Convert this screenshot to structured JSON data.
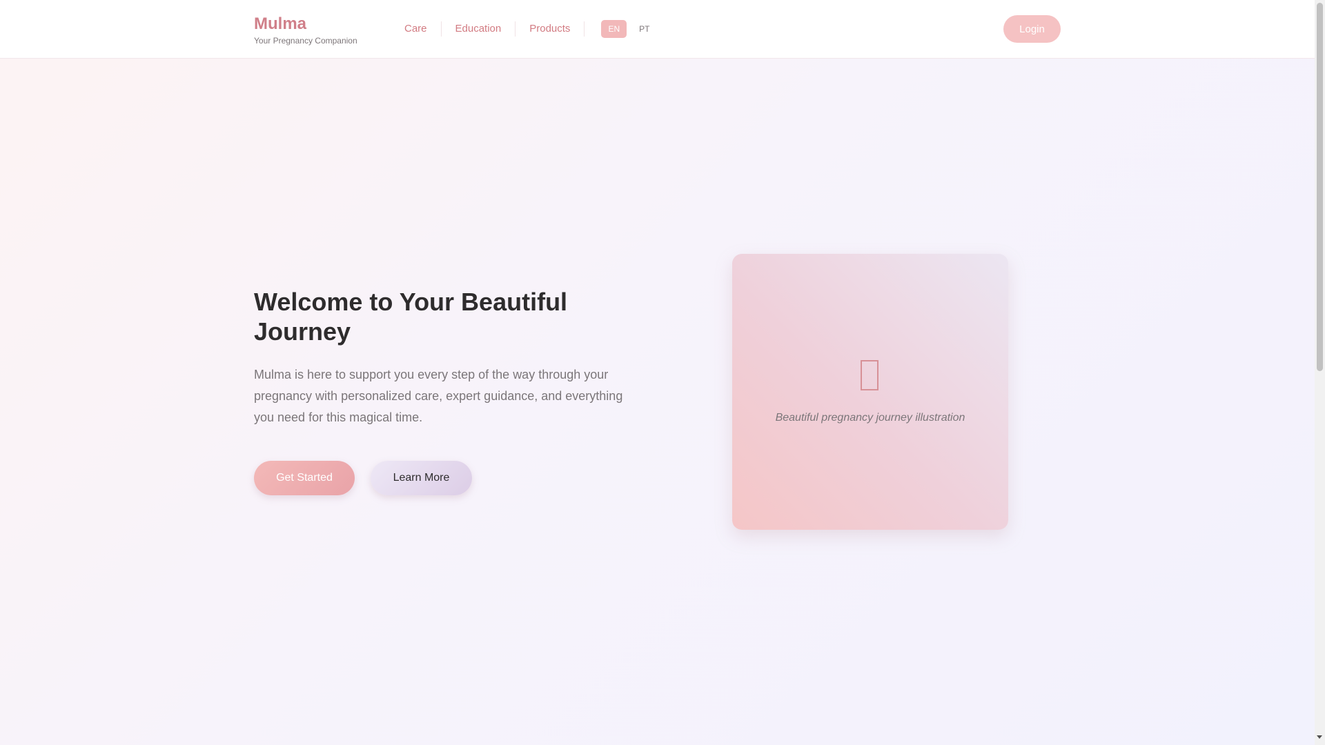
{
  "brand": {
    "name": "Mulma",
    "tagline": "Your Pregnancy Companion"
  },
  "nav": {
    "links": [
      {
        "label": "Care"
      },
      {
        "label": "Education"
      },
      {
        "label": "Products"
      }
    ],
    "languages": [
      {
        "label": "EN",
        "active": true
      },
      {
        "label": "PT",
        "active": false
      }
    ],
    "login_label": "Login"
  },
  "hero": {
    "title": "Welcome to Your Beautiful Journey",
    "description": "Mulma is here to support you every step of the way through your pregnancy with personalized care, expert guidance, and everything you need for this magical time.",
    "primary_button": "Get Started",
    "secondary_button": "Learn More"
  },
  "illustration": {
    "icon": "image-placeholder-icon",
    "caption": "Beautiful pregnancy journey illustration"
  },
  "colors": {
    "accent": "#d07f89",
    "button_pink": "#f3b9b8",
    "button_lavender": "#dccde6",
    "text_dark": "#2e2c2d",
    "text_muted": "#7b7679"
  }
}
